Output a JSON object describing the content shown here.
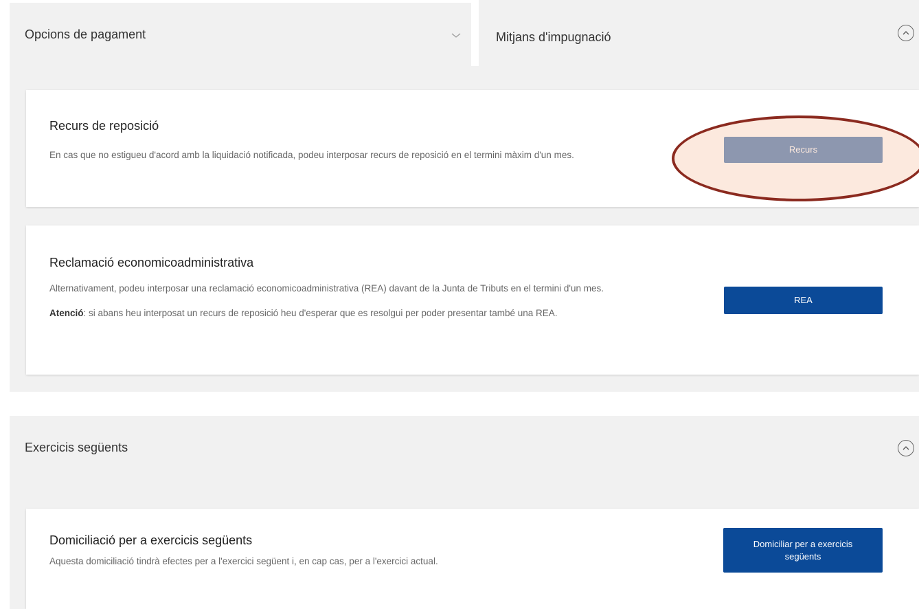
{
  "tabs": {
    "payment_options": {
      "label": "Opcions de pagament",
      "icon": "chevron-down-icon"
    },
    "appeal_means": {
      "label": "Mitjans d'impugnació",
      "icon": "circle-chevron-up-icon"
    }
  },
  "appeal_cards": {
    "reposition": {
      "title": "Recurs de reposició",
      "text": "En cas que no estigueu d'acord amb la liquidació notificada, podeu interposar recurs de reposició en el termini màxim d'un mes.",
      "button_label": "Recurs"
    },
    "rea": {
      "title": "Reclamació economicoadministrativa",
      "text": "Alternativament, podeu interposar una reclamació economicoadministrativa (REA) davant de la Junta de Tributs en el termini d'un mes.",
      "notice_label": "Atenció",
      "notice_text": ": si abans heu interposat un recurs de reposició heu d'esperar que es resolgui per poder presentar també una REA.",
      "button_label": "REA"
    }
  },
  "following_years": {
    "title": "Exercicis següents",
    "icon": "circle-chevron-up-icon",
    "card": {
      "title": "Domiciliació per a exercicis següents",
      "text": "Aquesta domiciliació tindrà efectes per a l'exercici següent i, en cap cas, per a l'exercici actual.",
      "button_label": "Domiciliar per a exercicis següents"
    }
  },
  "colors": {
    "button_blue": "#0b4a98",
    "panel_gray": "#f1f1f1",
    "highlight_ring": "#8b2a1f"
  }
}
